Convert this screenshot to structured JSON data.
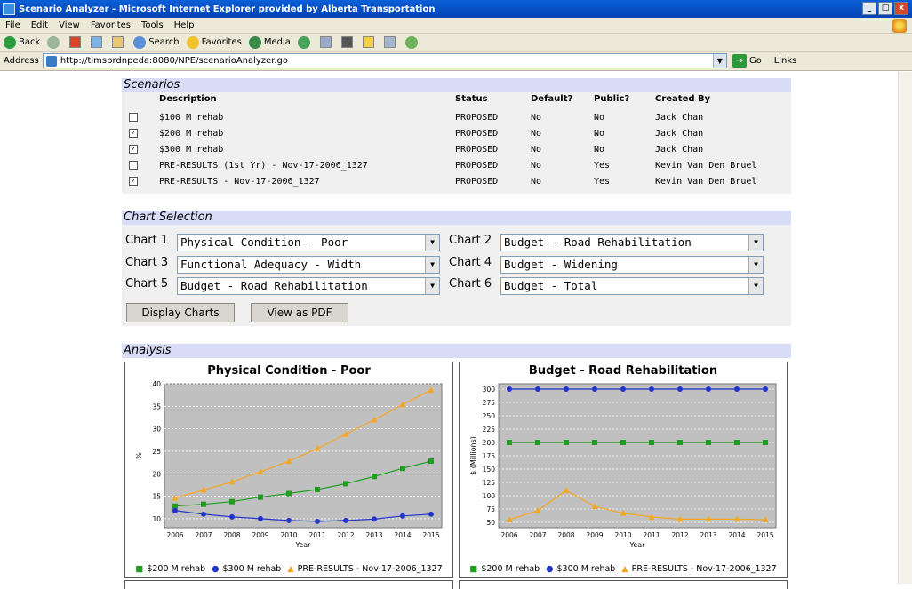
{
  "window": {
    "title": "Scenario Analyzer - Microsoft Internet Explorer provided by Alberta Transportation",
    "buttons": [
      "_",
      "□",
      "x"
    ]
  },
  "menu": [
    "File",
    "Edit",
    "View",
    "Favorites",
    "Tools",
    "Help"
  ],
  "toolbar": {
    "back": "Back",
    "search": "Search",
    "favorites": "Favorites",
    "media": "Media"
  },
  "address": {
    "label": "Address",
    "url": "http://timsprdnpeda:8080/NPE/scenarioAnalyzer.go",
    "go": "Go",
    "links": "Links"
  },
  "scenarios": {
    "title": "Scenarios",
    "headers": {
      "description": "Description",
      "status": "Status",
      "default": "Default?",
      "public": "Public?",
      "created_by": "Created By"
    },
    "rows": [
      {
        "checked": false,
        "description": "$100 M rehab",
        "status": "PROPOSED",
        "default": "No",
        "public": "No",
        "created_by": "Jack Chan"
      },
      {
        "checked": true,
        "description": "$200 M rehab",
        "status": "PROPOSED",
        "default": "No",
        "public": "No",
        "created_by": "Jack Chan"
      },
      {
        "checked": true,
        "description": "$300 M rehab",
        "status": "PROPOSED",
        "default": "No",
        "public": "No",
        "created_by": "Jack Chan"
      },
      {
        "checked": false,
        "description": "PRE-RESULTS (1st Yr) - Nov-17-2006_1327",
        "status": "PROPOSED",
        "default": "No",
        "public": "Yes",
        "created_by": "Kevin Van Den Bruel"
      },
      {
        "checked": true,
        "description": "PRE-RESULTS - Nov-17-2006_1327",
        "status": "PROPOSED",
        "default": "No",
        "public": "Yes",
        "created_by": "Kevin Van Den Bruel"
      }
    ]
  },
  "chart_selection": {
    "title": "Chart Selection",
    "charts": [
      {
        "label": "Chart 1",
        "value": "Physical Condition - Poor"
      },
      {
        "label": "Chart 2",
        "value": "Budget - Road Rehabilitation"
      },
      {
        "label": "Chart 3",
        "value": "Functional Adequacy - Width"
      },
      {
        "label": "Chart 4",
        "value": "Budget - Widening"
      },
      {
        "label": "Chart 5",
        "value": "Budget - Road Rehabilitation"
      },
      {
        "label": "Chart 6",
        "value": "Budget - Total"
      }
    ],
    "display_button": "Display Charts",
    "pdf_button": "View as PDF"
  },
  "analysis": {
    "title": "Analysis"
  },
  "colors": {
    "s200": "#1e9e1e",
    "s300": "#2233cc",
    "pre": "#f5a623",
    "plot_bg": "#c0c0c0"
  },
  "chart_data": [
    {
      "type": "line",
      "title": "Physical Condition - Poor",
      "xlabel": "Year",
      "ylabel": "%",
      "x": [
        "2006",
        "2007",
        "2008",
        "2009",
        "2010",
        "2011",
        "2012",
        "2013",
        "2014",
        "2015"
      ],
      "yticks": [
        10,
        15,
        20,
        25,
        30,
        35,
        40
      ],
      "ylim": [
        8,
        40
      ],
      "grid": true,
      "legend": "bottom",
      "series": [
        {
          "name": "$200 M rehab",
          "color": "#1e9e1e",
          "marker": "square",
          "values": [
            12.8,
            13.2,
            13.8,
            14.8,
            15.6,
            16.5,
            17.8,
            19.4,
            21.2,
            22.8
          ]
        },
        {
          "name": "$300 M rehab",
          "color": "#2233cc",
          "marker": "circle",
          "values": [
            11.8,
            11.0,
            10.4,
            10.0,
            9.6,
            9.4,
            9.6,
            9.9,
            10.6,
            11.0
          ]
        },
        {
          "name": "PRE-RESULTS - Nov-17-2006_1327",
          "color": "#f5a623",
          "marker": "triangle",
          "values": [
            14.6,
            16.4,
            18.2,
            20.4,
            22.8,
            25.6,
            28.8,
            32.0,
            35.4,
            38.6
          ]
        }
      ]
    },
    {
      "type": "line",
      "title": "Budget - Road Rehabilitation",
      "xlabel": "Year",
      "ylabel": "$ (Millions)",
      "x": [
        "2006",
        "2007",
        "2008",
        "2009",
        "2010",
        "2011",
        "2012",
        "2013",
        "2014",
        "2015"
      ],
      "yticks": [
        50,
        75,
        100,
        125,
        150,
        175,
        200,
        225,
        250,
        275,
        300
      ],
      "ylim": [
        40,
        310
      ],
      "grid": true,
      "legend": "bottom",
      "series": [
        {
          "name": "$200 M rehab",
          "color": "#1e9e1e",
          "marker": "square",
          "values": [
            200,
            200,
            200,
            200,
            200,
            200,
            200,
            200,
            200,
            200
          ]
        },
        {
          "name": "$300 M rehab",
          "color": "#2233cc",
          "marker": "circle",
          "values": [
            300,
            300,
            300,
            300,
            300,
            300,
            300,
            300,
            300,
            300
          ]
        },
        {
          "name": "PRE-RESULTS - Nov-17-2006_1327",
          "color": "#f5a623",
          "marker": "triangle",
          "values": [
            55,
            72,
            110,
            80,
            67,
            60,
            56,
            56,
            56,
            55
          ]
        }
      ]
    }
  ]
}
